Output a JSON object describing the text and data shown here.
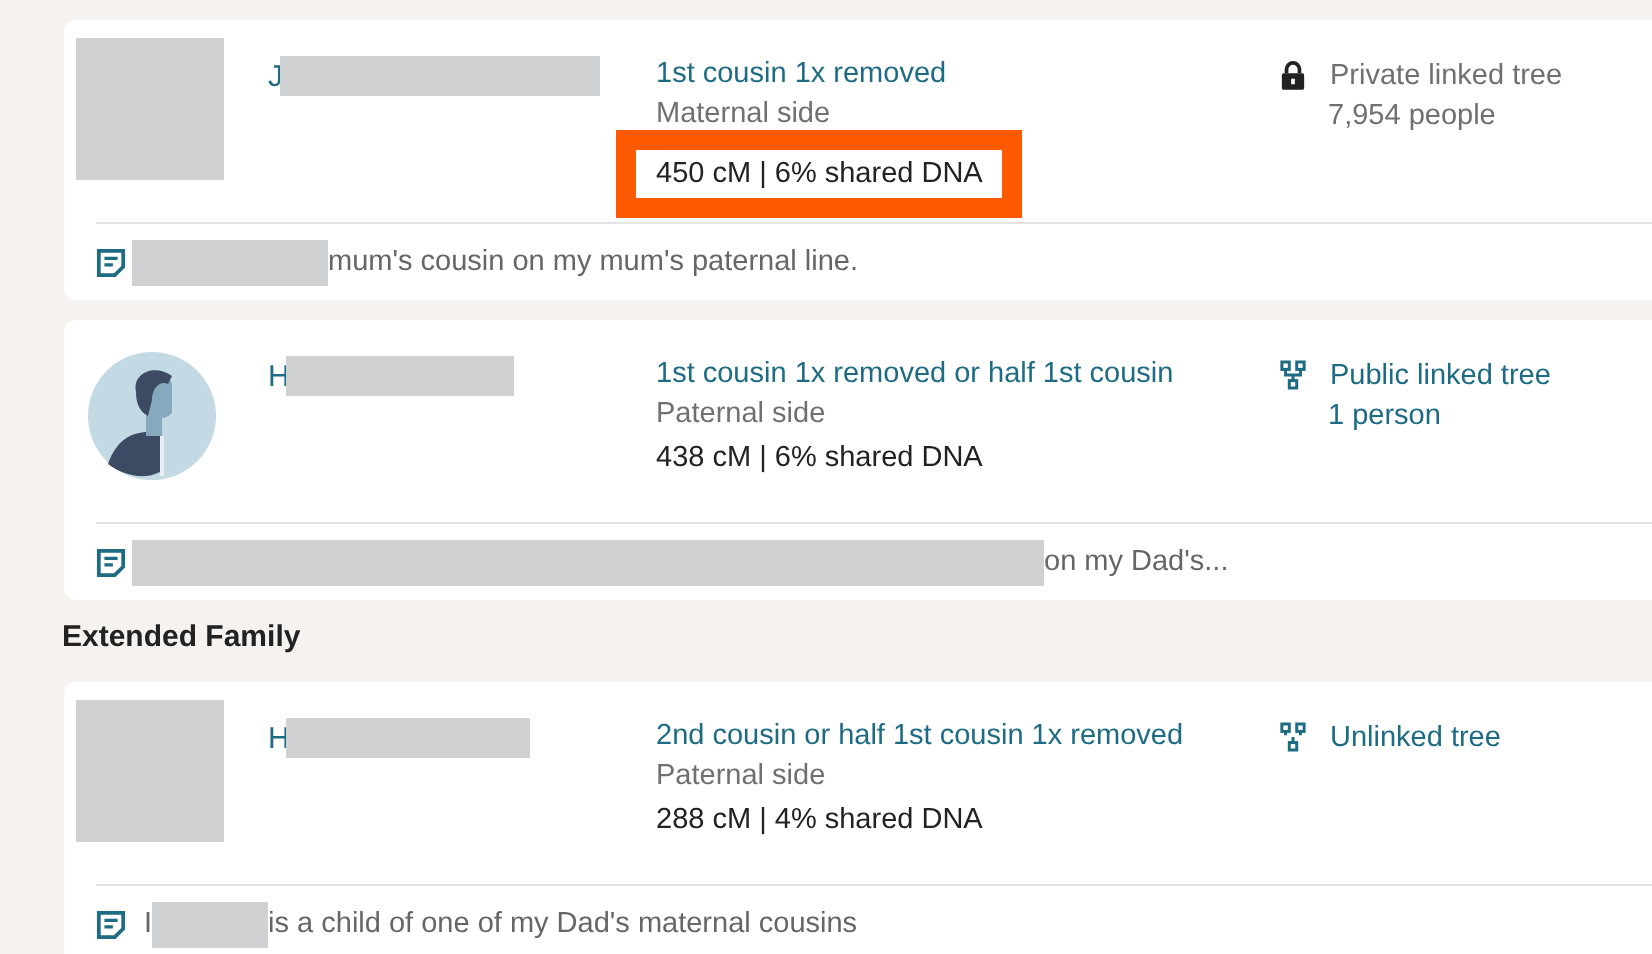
{
  "matches": [
    {
      "avatar": {
        "kind": "photo"
      },
      "name_initial": "J",
      "relationship": "1st cousin 1x removed",
      "side": "Maternal side",
      "dna": "450 cM | 6% shared DNA",
      "highlighted": true,
      "tree": {
        "kind": "private",
        "label": "Private linked tree",
        "count": "7,954 people"
      },
      "note": {
        "suffix": "mum's cousin on my mum's paternal line."
      }
    },
    {
      "avatar": {
        "kind": "silhouette"
      },
      "name_initial": "H",
      "relationship": "1st cousin 1x removed or half 1st cousin",
      "side": "Paternal side",
      "dna": "438 cM | 6% shared DNA",
      "highlighted": false,
      "tree": {
        "kind": "public",
        "label": "Public linked tree",
        "count": "1 person"
      },
      "note": {
        "suffix": "on my Dad's..."
      }
    }
  ],
  "section_heading": "Extended Family",
  "extended_matches": [
    {
      "avatar": {
        "kind": "photo"
      },
      "name_initial": "H",
      "relationship": "2nd cousin or half 1st cousin 1x removed",
      "side": "Paternal side",
      "dna": "288 cM | 4% shared DNA",
      "highlighted": false,
      "tree": {
        "kind": "unlinked",
        "label": "Unlinked tree"
      },
      "note": {
        "prefix": "I",
        "suffix": "is a child of one of my Dad's maternal cousins"
      }
    }
  ]
}
